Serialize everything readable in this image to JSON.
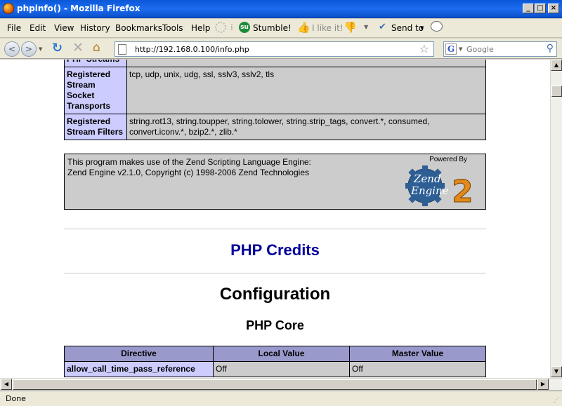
{
  "window": {
    "title": "phpinfo() - Mozilla Firefox"
  },
  "menu": {
    "file": "File",
    "edit": "Edit",
    "view": "View",
    "history": "History",
    "bookmarks": "Bookmarks",
    "tools": "Tools",
    "help": "Help",
    "stumble": "Stumble!",
    "ilike": "I like it!",
    "sendto": "Send to"
  },
  "nav": {
    "url": "http://192.168.0.100/info.php",
    "search_placeholder": "Google"
  },
  "streams_table": {
    "partial_row_label": "PHP Streams",
    "rows": [
      {
        "label": "Registered Stream Socket Transports",
        "value": "tcp, udp, unix, udg, ssl, sslv3, sslv2, tls"
      },
      {
        "label": "Registered Stream Filters",
        "value": "string.rot13, string.toupper, string.tolower, string.strip_tags, convert.*, consumed, convert.iconv.*, bzip2.*, zlib.*"
      }
    ]
  },
  "zend": {
    "line1": "This program makes use of the Zend Scripting Language Engine:",
    "line2": "Zend Engine v2.1.0, Copyright (c) 1998-2006 Zend Technologies",
    "powered_by": "Powered By",
    "logo_text": "Zend Engine 2"
  },
  "credits_heading": "PHP Credits",
  "config_heading": "Configuration",
  "core_heading": "PHP Core",
  "core_table": {
    "headers": [
      "Directive",
      "Local Value",
      "Master Value"
    ],
    "rows": [
      {
        "directive": "allow_call_time_pass_reference",
        "local": "Off",
        "master": "Off"
      }
    ]
  },
  "status": "Done"
}
